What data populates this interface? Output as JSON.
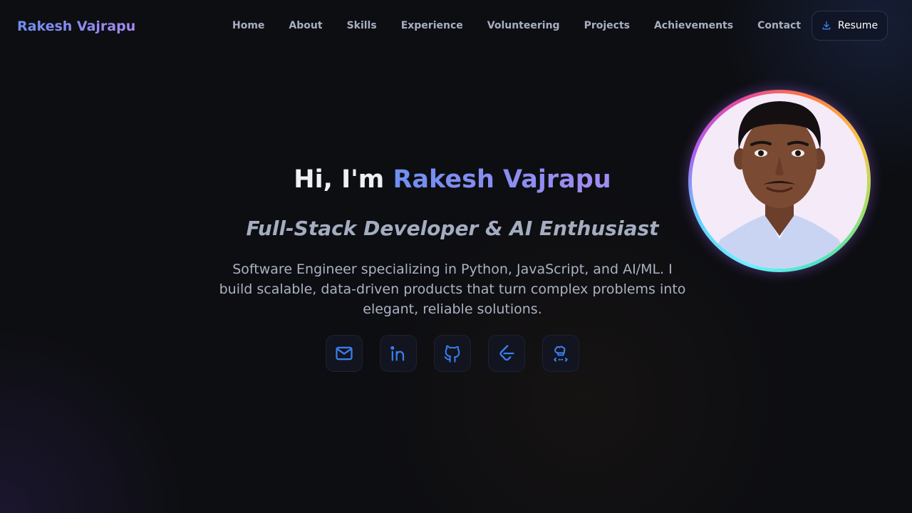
{
  "nav": {
    "brand": "Rakesh Vajrapu",
    "items": [
      {
        "label": "Home"
      },
      {
        "label": "About"
      },
      {
        "label": "Skills"
      },
      {
        "label": "Experience"
      },
      {
        "label": "Volunteering"
      },
      {
        "label": "Projects"
      },
      {
        "label": "Achievements"
      },
      {
        "label": "Contact"
      }
    ],
    "resume_label": "Resume",
    "resume_icon": "download-icon"
  },
  "hero": {
    "greeting": "Hi, I'm",
    "name": "Rakesh Vajrapu",
    "subtitle": "Full-Stack Developer & AI Enthusiast",
    "description": "Software Engineer specializing in Python, JavaScript, and AI/ML. I build scalable, data-driven products that turn complex problems into elegant, reliable solutions.",
    "socials": [
      {
        "icon": "email-icon"
      },
      {
        "icon": "linkedin-icon"
      },
      {
        "icon": "github-icon"
      },
      {
        "icon": "leetcode-icon"
      },
      {
        "icon": "codechef-icon"
      }
    ]
  },
  "colors": {
    "background": "#0d0e12",
    "accent_start": "#6e8ff2",
    "accent_end": "#a38cf0",
    "icon_blue": "#3b7ff0",
    "nav_text": "#a7afbf"
  }
}
